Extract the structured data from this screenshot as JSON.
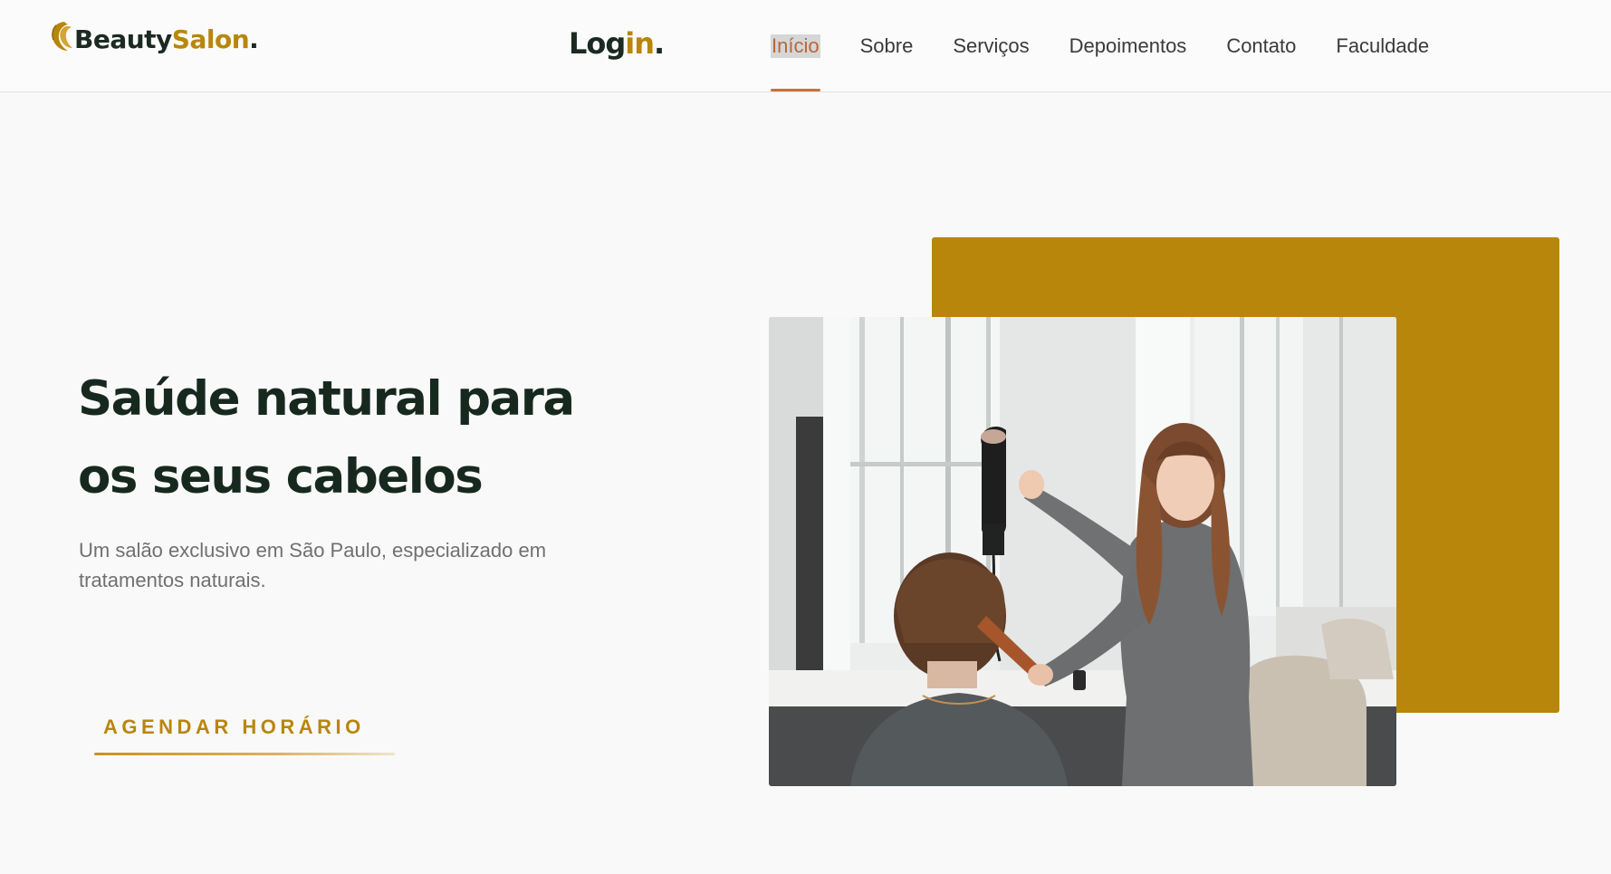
{
  "brand": {
    "logo_part1": "Beauty",
    "logo_part2": "Salon",
    "logo_dot": ".",
    "logo_mark": "hair-swirl-icon"
  },
  "login": {
    "part1": "Log",
    "part2": "in",
    "dot": "."
  },
  "nav": {
    "items": [
      {
        "label": "Início",
        "active": true
      },
      {
        "label": "Sobre"
      },
      {
        "label": "Serviços"
      },
      {
        "label": "Depoimentos"
      },
      {
        "label": "Contato"
      },
      {
        "label": "Faculdade"
      }
    ]
  },
  "hero": {
    "title_line1": "Saúde natural para",
    "title_line2": "os seus cabelos",
    "subtitle_line1": "Um salão exclusivo em São Paulo, especializado em",
    "subtitle_line2": "tratamentos naturais.",
    "cta_label": "AGENDAR HORÁRIO",
    "image_subject": "hairdresser-blow-drying-client-photo"
  },
  "colors": {
    "accent_gold": "#b8860b",
    "dark_green": "#17291f",
    "nav_active": "#b5683b",
    "background": "#f9f9f9"
  }
}
